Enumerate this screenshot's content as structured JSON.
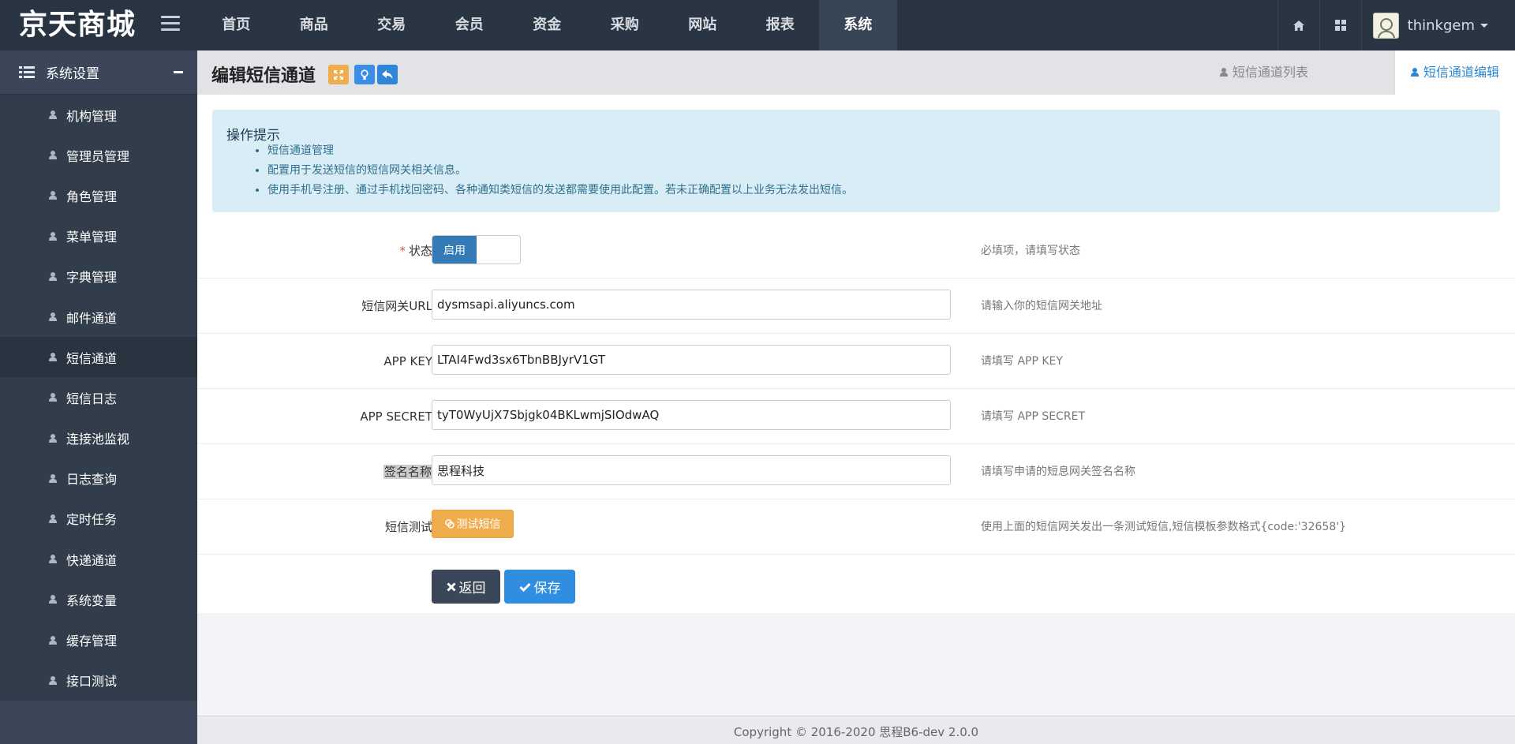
{
  "app": {
    "brand": "京天商城"
  },
  "mainnav": {
    "items": [
      "首页",
      "商品",
      "交易",
      "会员",
      "资金",
      "采购",
      "网站",
      "报表",
      "系统"
    ],
    "active_index": 8
  },
  "user": {
    "name": "thinkgem"
  },
  "sidebar": {
    "header": "系统设置",
    "items": [
      {
        "label": "机构管理"
      },
      {
        "label": "管理员管理"
      },
      {
        "label": "角色管理"
      },
      {
        "label": "菜单管理"
      },
      {
        "label": "字典管理"
      },
      {
        "label": "邮件通道"
      },
      {
        "label": "短信通道"
      },
      {
        "label": "短信日志"
      },
      {
        "label": "连接池监视"
      },
      {
        "label": "日志查询"
      },
      {
        "label": "定时任务"
      },
      {
        "label": "快递通道"
      },
      {
        "label": "系统变量"
      },
      {
        "label": "缓存管理"
      },
      {
        "label": "接口测试"
      }
    ],
    "active_index": 6
  },
  "page": {
    "title": "编辑短信通道",
    "tab_list": "短信通道列表",
    "tab_edit": "短信通道编辑"
  },
  "tips": {
    "title": "操作提示",
    "items": [
      "短信通道管理",
      "配置用于发送短信的短信网关相关信息。",
      "使用手机号注册、通过手机找回密码、各种通知类短信的发送都需要使用此配置。若未正确配置以上业务无法发出短信。"
    ]
  },
  "form": {
    "status": {
      "required_mark": "*",
      "label": "状态：",
      "on_label": "启用",
      "hint": "必填项，请填写状态"
    },
    "gateway_url": {
      "label": "短信网关URL：",
      "value": "dysmsapi.aliyuncs.com",
      "hint": "请输入你的短信网关地址"
    },
    "app_key": {
      "label": "APP KEY：",
      "value": "LTAI4Fwd3sx6TbnBBJyrV1GT",
      "hint": "请填写 APP KEY"
    },
    "app_secret": {
      "label": "APP SECRET：",
      "value": "tyT0WyUjX7Sbjgk04BKLwmjSIOdwAQ",
      "hint": "请填写 APP SECRET"
    },
    "sign_name": {
      "label": "签名名称",
      "label_suffix": "：",
      "value": "思程科技",
      "hint": "请填写申请的短息网关签名名称"
    },
    "sms_test": {
      "label": "短信测试：",
      "button": "测试短信",
      "hint": "使用上面的短信网关发出一条测试短信,短信模板参数格式{code:'32658'}"
    }
  },
  "actions": {
    "back": "返回",
    "save": "保存"
  },
  "footer": {
    "copyright": "Copyright © 2016-2020  思程B6-dev  2.0.0"
  },
  "colors": {
    "topbar": "#2a3543",
    "sidebar": "#323d4b",
    "primary": "#2f8ee0",
    "warning": "#f0ad4e",
    "tips_bg": "#d9edf7"
  }
}
